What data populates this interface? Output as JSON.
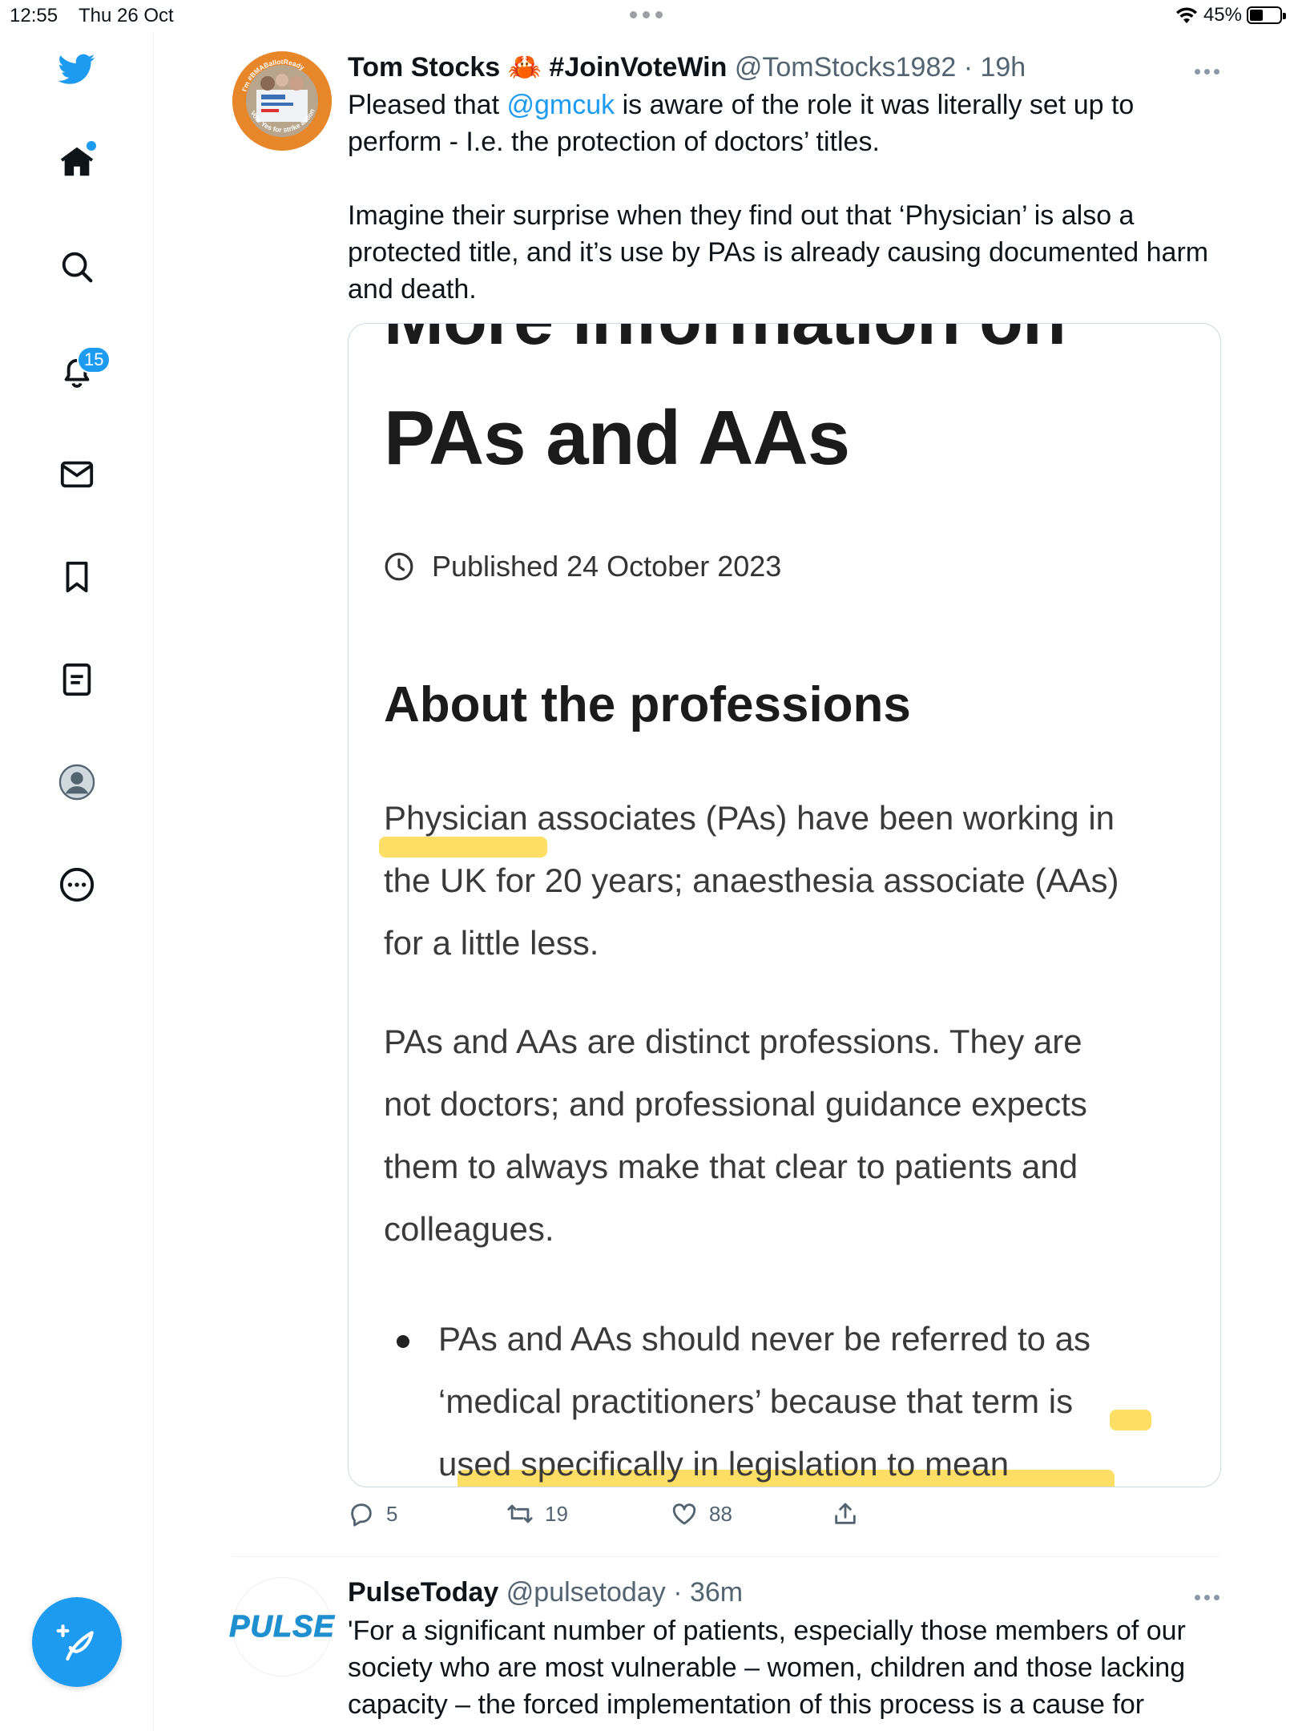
{
  "status_bar": {
    "time": "12:55",
    "date": "Thu 26 Oct",
    "battery": "45%",
    "battery_level": 0.45
  },
  "sidebar": {
    "notifications_count": "15"
  },
  "tweet1": {
    "name": "Tom Stocks 🦀 #JoinVoteWin",
    "handle": "@TomStocks1982",
    "sep": " · ",
    "time": "19h",
    "line1_pre": "Pleased that ",
    "line1_mention": "@gmcuk",
    "line1_post": " is aware of the role it was literally set up to",
    "line2": "perform - I.e. the protection of doctors’ titles.",
    "para2_line1": "Imagine their surprise when they find out that ‘Physician’ is also a",
    "para2_line2": "protected title, and it’s use by PAs is already causing documented harm",
    "para2_line3": "and death.",
    "avatar_text_top": "I'm #BMABallotReady",
    "avatar_text_bottom": "Vote Yes for strike action",
    "image": {
      "title_cut": "More information on",
      "title": "PAs and AAs",
      "published": "Published 24 October 2023",
      "heading": "About the professions",
      "para1": [
        "Physician associates (PAs) have been working in",
        "the UK for 20 years; anaesthesia associate (AAs)",
        "for a little less."
      ],
      "para2": [
        "PAs and AAs are distinct professions. They are",
        "not doctors; and professional guidance expects",
        "them to always make that clear to patients and",
        "colleagues."
      ],
      "bullet": [
        "PAs and AAs should never be referred to as",
        "‘medical practitioners’ because that term is",
        "used specifically in legislation to mean"
      ]
    },
    "replies": "5",
    "retweets": "19",
    "likes": "88"
  },
  "tweet2": {
    "name": "PulseToday",
    "handle": "@pulsetoday",
    "sep": " · ",
    "time": "36m",
    "logo": "PULSE",
    "line1": "'For a significant number of patients, especially those members of our",
    "line2": "society who are most vulnerable – women, children and those lacking",
    "line3": "capacity – the forced implementation of this process is a cause for"
  },
  "colors": {
    "accent": "#1d9bf0",
    "highlight": "#ffd84a",
    "text_secondary": "#536471"
  }
}
